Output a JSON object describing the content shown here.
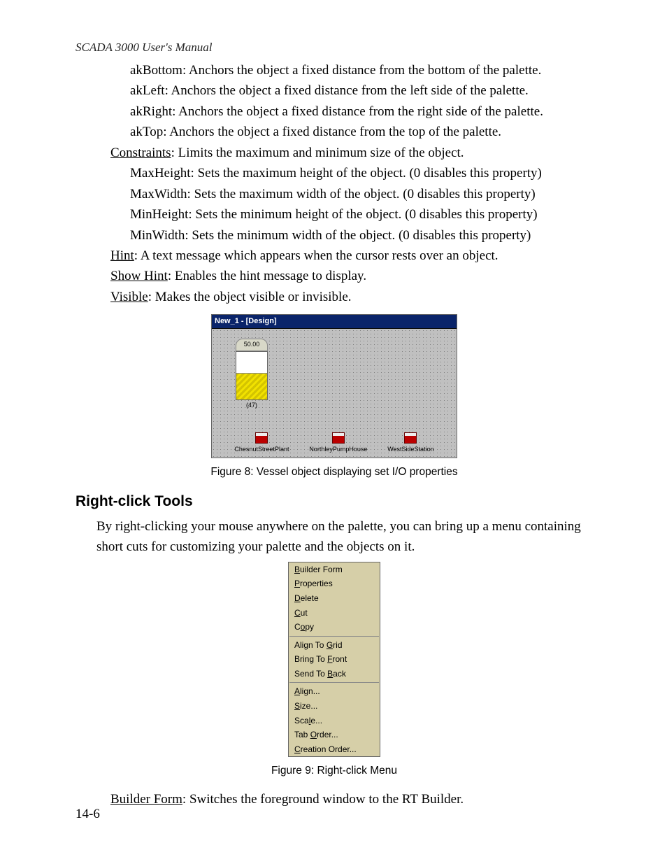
{
  "header": "SCADA 3000 User's Manual",
  "defs": {
    "akBottom": "akBottom: Anchors the object a fixed distance from the bottom of the palette.",
    "akLeft": "akLeft: Anchors the object a fixed distance from the left side of the palette.",
    "akRight": "akRight: Anchors the object a fixed distance from the right side of the palette.",
    "akTop": "akTop: Anchors the object a fixed distance from the top of the palette.",
    "constraints_label": "Constraints",
    "constraints_rest": ": Limits the maximum and minimum size of the object.",
    "maxHeight": "MaxHeight: Sets the maximum height of the object. (0 disables this property)",
    "maxWidth": "MaxWidth: Sets the maximum width of the object. (0 disables this property)",
    "minHeight": "MinHeight: Sets the minimum height of the object. (0 disables this property)",
    "minWidth": "MinWidth: Sets the minimum width of the object. (0 disables this property)",
    "hint_label": "Hint",
    "hint_rest": ": A text message which appears when the cursor rests over an object.",
    "showhint_label": "Show Hint",
    "showhint_rest": ": Enables the hint message to display.",
    "visible_label": "Visible",
    "visible_rest": ": Makes the object visible or invisible."
  },
  "fig8": {
    "title": "New_1 - [Design]",
    "vessel_top": "50.00",
    "vessel_bottom": "(47)",
    "plants": [
      "ChesnutStreetPlant",
      "NorthleyPumpHouse",
      "WestSideStation"
    ],
    "caption": "Figure 8: Vessel object displaying set I/O properties"
  },
  "section": {
    "heading": "Right-click Tools",
    "body": "By right-clicking your mouse anywhere on the palette, you can bring up a menu containing short cuts for customizing your palette and the objects on it."
  },
  "fig9": {
    "group1": [
      {
        "pre": "",
        "mn": "B",
        "post": "uilder Form"
      },
      {
        "pre": "",
        "mn": "P",
        "post": "roperties"
      },
      {
        "pre": "",
        "mn": "D",
        "post": "elete"
      },
      {
        "pre": "",
        "mn": "C",
        "post": "ut"
      },
      {
        "pre": "C",
        "mn": "o",
        "post": "py"
      }
    ],
    "group2": [
      {
        "pre": "Align To ",
        "mn": "G",
        "post": "rid"
      },
      {
        "pre": "Bring To ",
        "mn": "F",
        "post": "ront"
      },
      {
        "pre": "Send To ",
        "mn": "B",
        "post": "ack"
      }
    ],
    "group3": [
      {
        "pre": "",
        "mn": "A",
        "post": "lign..."
      },
      {
        "pre": "",
        "mn": "S",
        "post": "ize..."
      },
      {
        "pre": "Sca",
        "mn": "l",
        "post": "e..."
      },
      {
        "pre": "Tab ",
        "mn": "O",
        "post": "rder..."
      },
      {
        "pre": "",
        "mn": "C",
        "post": "reation Order..."
      }
    ],
    "caption": "Figure 9: Right-click Menu"
  },
  "after_fig9": {
    "label": "Builder Form",
    "rest": ": Switches the foreground window to the RT Builder."
  },
  "pagenum": "14-6"
}
